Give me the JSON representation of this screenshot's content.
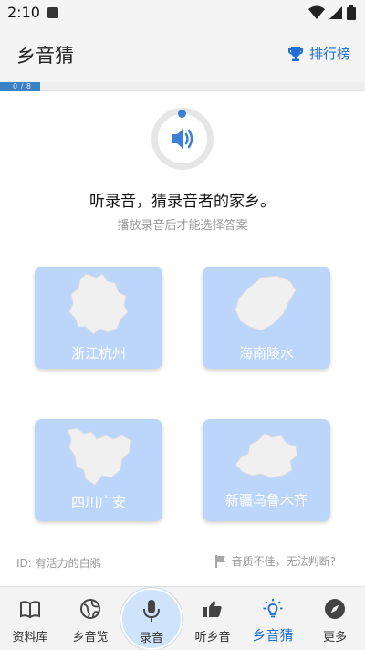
{
  "status": {
    "time": "2:10"
  },
  "header": {
    "title": "乡音猜",
    "leaderboard_label": "排行榜"
  },
  "progress": {
    "text": "0 / 8",
    "fraction": 0.11
  },
  "main": {
    "prompt": "听录音，猜录音者的家乡。",
    "hint": "播放录音后才能选择答案"
  },
  "options": [
    {
      "label": "浙江杭州",
      "icon": "zhejiang-map-icon"
    },
    {
      "label": "海南陵水",
      "icon": "hainan-map-icon"
    },
    {
      "label": "四川广安",
      "icon": "sichuan-map-icon"
    },
    {
      "label": "新疆乌鲁木齐",
      "icon": "xinjiang-map-icon"
    }
  ],
  "footer": {
    "user_id": "ID: 有活力的白鹇",
    "report_label": "音质不佳，无法判断?"
  },
  "nav": [
    {
      "label": "资料库",
      "icon": "book-icon"
    },
    {
      "label": "乡音览",
      "icon": "globe-icon"
    },
    {
      "label": "录音",
      "icon": "microphone-icon"
    },
    {
      "label": "听乡音",
      "icon": "thumbs-up-icon"
    },
    {
      "label": "乡音猜",
      "icon": "lightbulb-icon"
    },
    {
      "label": "更多",
      "icon": "compass-icon"
    }
  ],
  "colors": {
    "accent": "#1f6fd6",
    "card": "#bcd6fb",
    "progress": "#3b82c4"
  }
}
